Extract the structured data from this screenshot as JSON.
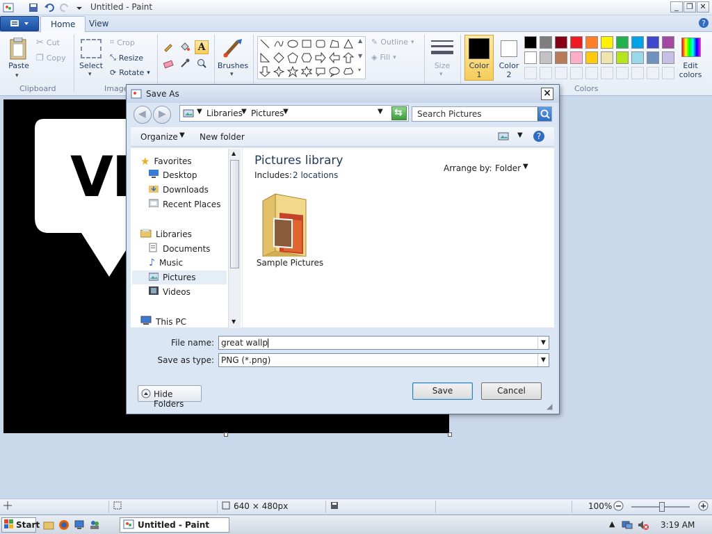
{
  "window": {
    "title": "Untitled - Paint",
    "controls": {
      "minimize": "_",
      "maximize": "❐",
      "close": "✕"
    }
  },
  "ribbon": {
    "tabs": [
      {
        "label": "Home",
        "active": true
      },
      {
        "label": "View",
        "active": false
      }
    ],
    "clipboard": {
      "paste": "Paste",
      "cut": "Cut",
      "copy": "Copy",
      "group": "Clipboard"
    },
    "image": {
      "select": "Select",
      "crop": "Crop",
      "resize": "Resize",
      "rotate": "Rotate",
      "group": "Image"
    },
    "brushes": "Brushes",
    "shapes": {
      "outline": "Outline",
      "fill": "Fill"
    },
    "size": "Size",
    "colors": {
      "color1_line1": "Color",
      "color1_line2": "1",
      "color2_line1": "Color",
      "color2_line2": "2",
      "edit_line1": "Edit",
      "edit_line2": "colors",
      "group": "Colors",
      "color1_value": "#000000",
      "color2_value": "#ffffff",
      "palette_row1": [
        "#000000",
        "#7f7f7f",
        "#880015",
        "#ed1c24",
        "#ff7f27",
        "#fff200",
        "#22b14c",
        "#00a2e8",
        "#3f48cc",
        "#a349a4"
      ],
      "palette_row2": [
        "#ffffff",
        "#c3c3c3",
        "#b97a57",
        "#ffaec9",
        "#ffc90e",
        "#efe4b0",
        "#b5e61d",
        "#99d9ea",
        "#7092be",
        "#c8bfe7"
      ]
    }
  },
  "canvas_text": "VM",
  "status": {
    "dimensions": "640 × 480px",
    "zoom": "100%"
  },
  "dialog": {
    "title": "Save As",
    "breadcrumb": [
      "Libraries",
      "Pictures"
    ],
    "search_placeholder": "Search Pictures",
    "toolbar": {
      "organize": "Organize",
      "new_folder": "New folder"
    },
    "nav": {
      "favorites": "Favorites",
      "desktop": "Desktop",
      "downloads": "Downloads",
      "recent_places": "Recent Places",
      "libraries": "Libraries",
      "documents": "Documents",
      "music": "Music",
      "pictures": "Pictures",
      "videos": "Videos",
      "this_pc": "This PC"
    },
    "content": {
      "heading": "Pictures library",
      "includes_label": "Includes:",
      "includes_link": "2 locations",
      "arrange_label": "Arrange by:",
      "arrange_value": "Folder",
      "items": [
        {
          "name": "Sample Pictures"
        }
      ]
    },
    "file_name_label": "File name:",
    "file_name_value": "great wallp",
    "save_type_label": "Save as type:",
    "save_type_value": "PNG (*.png)",
    "hide_folders": "Hide Folders",
    "save": "Save",
    "cancel": "Cancel"
  },
  "taskbar": {
    "start": "Start",
    "task_paint": "Untitled - Paint",
    "clock": "3:19 AM"
  }
}
